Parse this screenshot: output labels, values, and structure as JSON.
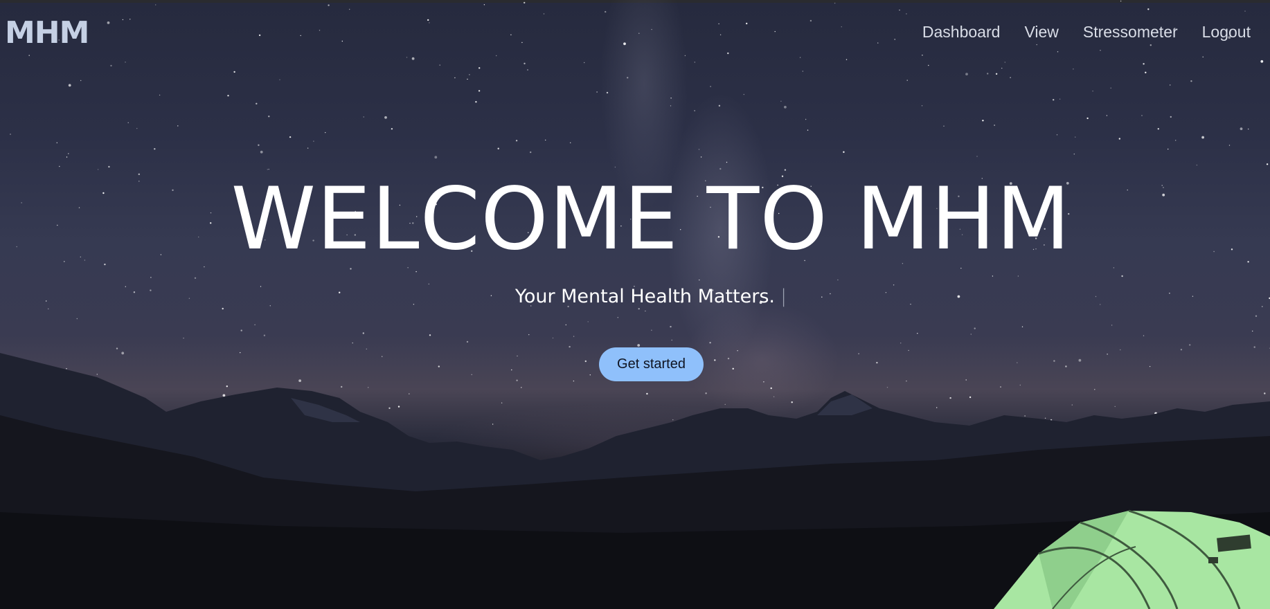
{
  "nav": {
    "logo": "MHM",
    "links": [
      {
        "label": "Dashboard"
      },
      {
        "label": "View"
      },
      {
        "label": "Stressometer"
      },
      {
        "label": "Logout"
      }
    ]
  },
  "hero": {
    "title": "WELCOME TO MHM",
    "subtitle": "Your Mental Health Matters.",
    "cursor": "|",
    "cta_label": "Get started"
  },
  "colors": {
    "accent_button": "#8fc0fb",
    "logo": "#c5d0e4",
    "tent": "#a8e6a2"
  },
  "background": {
    "scene": "night sky with milky way over mountain range, lit green tent"
  }
}
